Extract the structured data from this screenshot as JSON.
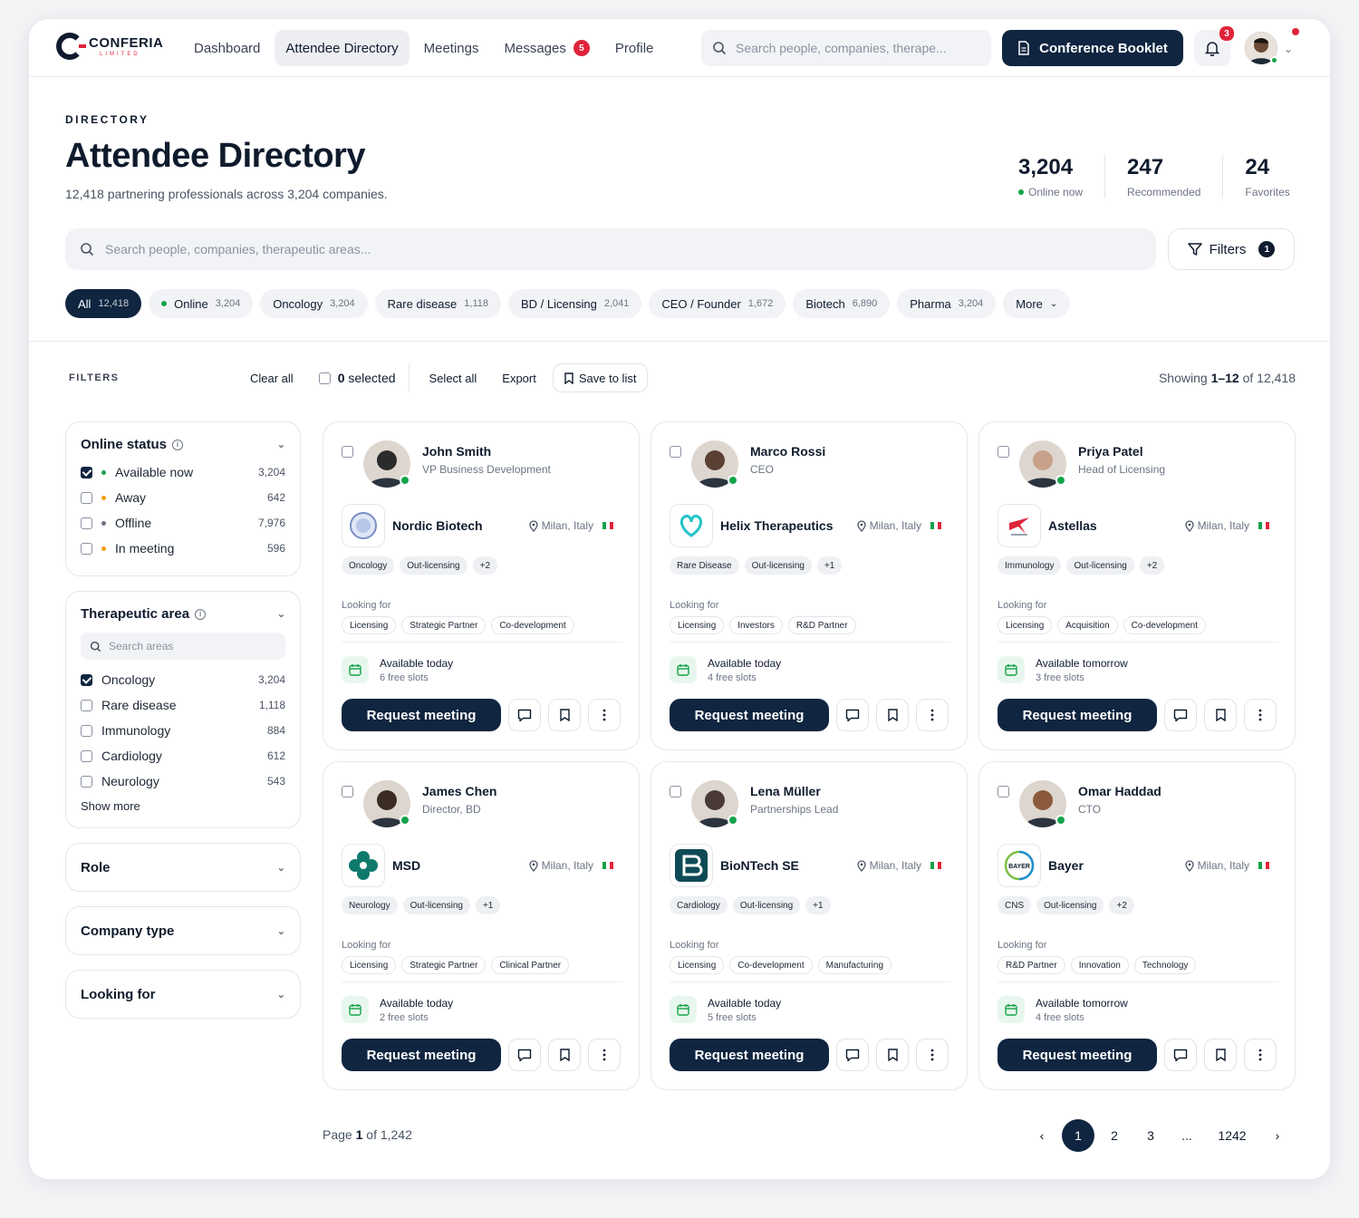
{
  "brand": {
    "name": "CONFERIA",
    "sub": "LIMITED"
  },
  "nav": {
    "items": [
      {
        "label": "Dashboard"
      },
      {
        "label": "Attendee Directory"
      },
      {
        "label": "Meetings"
      },
      {
        "label": "Messages",
        "badge": "5"
      },
      {
        "label": "Profile"
      }
    ],
    "search_placeholder": "Search people, companies, therape...",
    "booklet_label": "Conference Booklet",
    "notif_count": "3"
  },
  "header": {
    "eyebrow": "DIRECTORY",
    "title": "Attendee Directory",
    "subtitle": "12,418 partnering professionals across 3,204 companies.",
    "stats": [
      {
        "value": "3,204",
        "label": "Online now"
      },
      {
        "value": "247",
        "label": "Recommended"
      },
      {
        "value": "24",
        "label": "Favorites"
      }
    ]
  },
  "search": {
    "placeholder": "Search people, companies, therapeutic areas...",
    "filters_label": "Filters",
    "filters_count": "1"
  },
  "chips": [
    {
      "label": "All",
      "count": "12,418"
    },
    {
      "label": "Online",
      "count": "3,204"
    },
    {
      "label": "Oncology",
      "count": "3,204"
    },
    {
      "label": "Rare disease",
      "count": "1,118"
    },
    {
      "label": "BD / Licensing",
      "count": "2,041"
    },
    {
      "label": "CEO / Founder",
      "count": "1,672"
    },
    {
      "label": "Biotech",
      "count": "6,890"
    },
    {
      "label": "Pharma",
      "count": "3,204"
    },
    {
      "label": "More",
      "count": ""
    }
  ],
  "toolbar": {
    "filters": "FILTERS",
    "clear_all": "Clear all",
    "selected_count": "0",
    "selected_word": "selected",
    "select_all": "Select all",
    "export": "Export",
    "save_to_list": "Save to list",
    "showing_prefix": "Showing",
    "showing_range": "1–12",
    "showing_suffix": "of 12,418"
  },
  "sidebar": {
    "online": {
      "title": "Online status",
      "options": [
        {
          "label": "Available now",
          "count": "3,204",
          "checked": true,
          "color": "#16a34a"
        },
        {
          "label": "Away",
          "count": "642",
          "checked": false,
          "color": "#f59e0b"
        },
        {
          "label": "Offline",
          "count": "7,976",
          "checked": false,
          "color": "#6b7483"
        },
        {
          "label": "In meeting",
          "count": "596",
          "checked": false,
          "color": "#f59e0b"
        }
      ]
    },
    "therapeutic": {
      "title": "Therapeutic area",
      "search_placeholder": "Search areas",
      "options": [
        {
          "label": "Oncology",
          "count": "3,204",
          "checked": true
        },
        {
          "label": "Rare disease",
          "count": "1,118",
          "checked": false
        },
        {
          "label": "Immunology",
          "count": "884",
          "checked": false
        },
        {
          "label": "Cardiology",
          "count": "612",
          "checked": false
        },
        {
          "label": "Neurology",
          "count": "543",
          "checked": false
        }
      ],
      "show_more": "Show more"
    },
    "role": {
      "title": "Role"
    },
    "company_type": {
      "title": "Company type"
    },
    "looking_for": {
      "title": "Looking for"
    }
  },
  "cards": [
    {
      "name": "John Smith",
      "role": "VP Business Development",
      "company": "Nordic Biotech",
      "location": "Milan, Italy",
      "tags": [
        "Oncology",
        "Out-licensing",
        "+2"
      ],
      "looking_label": "Looking for",
      "looking": [
        "Licensing",
        "Strategic Partner",
        "Co-development"
      ],
      "avail": "Available today",
      "slots": "6 free slots",
      "cta": "Request meeting",
      "avatar_color": "#2b2b2b"
    },
    {
      "name": "Marco Rossi",
      "role": "CEO",
      "company": "Helix Therapeutics",
      "location": "Milan, Italy",
      "tags": [
        "Rare Disease",
        "Out-licensing",
        "+1"
      ],
      "looking_label": "Looking for",
      "looking": [
        "Licensing",
        "Investors",
        "R&D Partner"
      ],
      "avail": "Available today",
      "slots": "4 free slots",
      "cta": "Request meeting",
      "avatar_color": "#5a4032"
    },
    {
      "name": "Priya Patel",
      "role": "Head of Licensing",
      "company": "Astellas",
      "location": "Milan, Italy",
      "tags": [
        "Immunology",
        "Out-licensing",
        "+2"
      ],
      "looking_label": "Looking for",
      "looking": [
        "Licensing",
        "Acquisition",
        "Co-development"
      ],
      "avail": "Available tomorrow",
      "slots": "3 free slots",
      "cta": "Request meeting",
      "avatar_color": "#c9a18a"
    },
    {
      "name": "James Chen",
      "role": "Director, BD",
      "company": "MSD",
      "location": "Milan, Italy",
      "tags": [
        "Neurology",
        "Out-licensing",
        "+1"
      ],
      "looking_label": "Looking for",
      "looking": [
        "Licensing",
        "Strategic Partner",
        "Clinical Partner"
      ],
      "avail": "Available today",
      "slots": "2 free slots",
      "cta": "Request meeting",
      "avatar_color": "#3a2c22"
    },
    {
      "name": "Lena Müller",
      "role": "Partnerships Lead",
      "company": "BioNTech SE",
      "location": "Milan, Italy",
      "tags": [
        "Cardiology",
        "Out-licensing",
        "+1"
      ],
      "looking_label": "Looking for",
      "looking": [
        "Licensing",
        "Co-development",
        "Manufacturing"
      ],
      "avail": "Available today",
      "slots": "5 free slots",
      "cta": "Request meeting",
      "avatar_color": "#4a3a36"
    },
    {
      "name": "Omar Haddad",
      "role": "CTO",
      "company": "Bayer",
      "location": "Milan, Italy",
      "tags": [
        "CNS",
        "Out-licensing",
        "+2"
      ],
      "looking_label": "Looking for",
      "looking": [
        "R&D Partner",
        "Innovation",
        "Technology"
      ],
      "avail": "Available tomorrow",
      "slots": "4 free slots",
      "cta": "Request meeting",
      "avatar_color": "#8a5a3a"
    }
  ],
  "pagination": {
    "page_word": "Page",
    "current": "1",
    "of_text": "of 1,242",
    "pages": [
      "1",
      "2",
      "3",
      "...",
      "1242"
    ]
  }
}
